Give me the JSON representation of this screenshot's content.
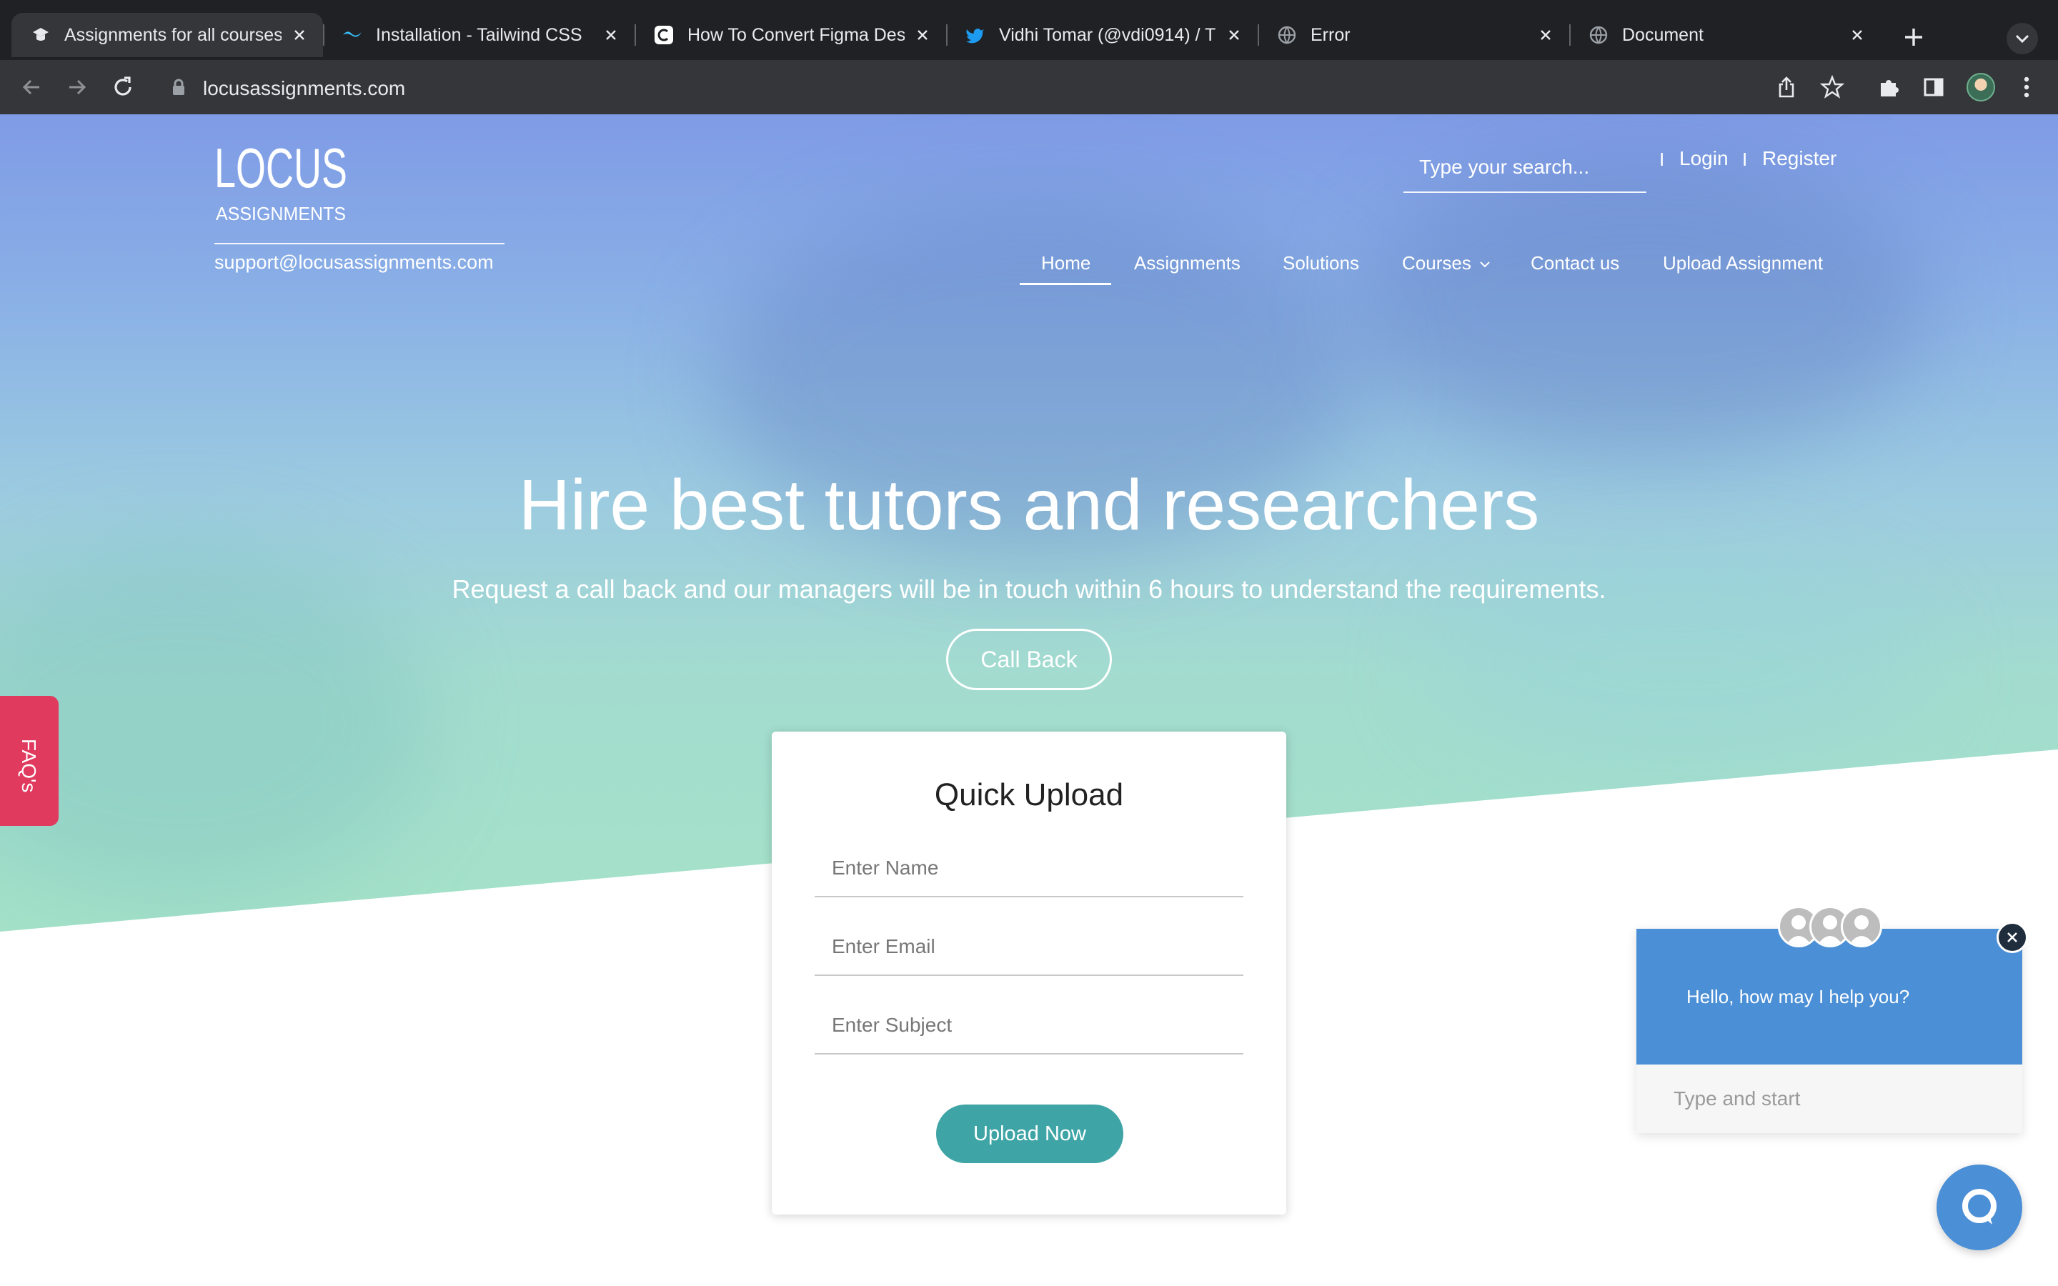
{
  "browser": {
    "tabs": [
      {
        "title": "Assignments for all courses",
        "icon": "graduation-cap-icon"
      },
      {
        "title": "Installation - Tailwind CSS",
        "icon": "tailwind-icon"
      },
      {
        "title": "How To Convert Figma Des",
        "icon": "c-logo-icon"
      },
      {
        "title": "Vidhi Tomar (@vdi0914) / T",
        "icon": "twitter-icon"
      },
      {
        "title": "Error",
        "icon": "globe-icon"
      },
      {
        "title": "Document",
        "icon": "globe-icon"
      }
    ],
    "url": "locusassignments.com"
  },
  "header": {
    "logo_text": "LOCUS",
    "logo_subtext": "ASSIGNMENTS",
    "support_email": "support@locusassignments.com",
    "search_placeholder": "Type your search...",
    "separator": "I",
    "login": "Login",
    "register": "Register"
  },
  "nav": {
    "items": [
      "Home",
      "Assignments",
      "Solutions",
      "Courses",
      "Contact us",
      "Upload Assignment"
    ],
    "active": "Home"
  },
  "hero": {
    "title": "Hire best tutors and researchers",
    "subtitle": "Request a call back and our managers will be in touch within 6 hours to understand the requirements.",
    "cta": "Call Back"
  },
  "faq_tab": "FAQ's",
  "quick_upload": {
    "title": "Quick Upload",
    "name_placeholder": "Enter Name",
    "email_placeholder": "Enter Email",
    "subject_placeholder": "Enter Subject",
    "button": "Upload Now"
  },
  "chat": {
    "greeting": "Hello, how may I help you?",
    "input_placeholder": "Type and start"
  },
  "colors": {
    "chrome_dark": "#202124",
    "chrome_toolbar": "#35363a",
    "faq_red": "#e03b5e",
    "upload_teal": "#3fa4a6",
    "chat_blue": "#4b8fd6"
  }
}
